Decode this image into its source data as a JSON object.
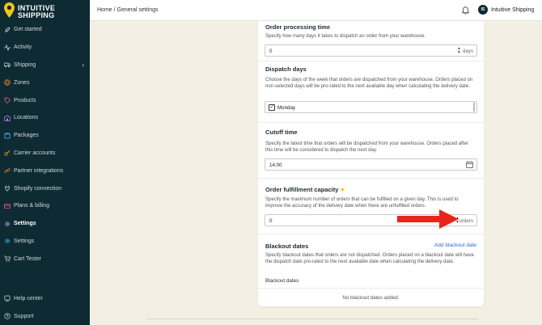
{
  "brand": {
    "line1": "INTUITIVE",
    "line2": "SHIPPING",
    "accent": "#f0c419"
  },
  "sidebar": {
    "items": [
      {
        "label": "Get started",
        "icon": "rocket-icon"
      },
      {
        "label": "Activity",
        "icon": "activity-icon"
      },
      {
        "label": "Shipping",
        "icon": "truck-icon",
        "has_chevron": true
      },
      {
        "label": "Zones",
        "icon": "globe-icon"
      },
      {
        "label": "Products",
        "icon": "tag-icon"
      },
      {
        "label": "Locations",
        "icon": "building-icon"
      },
      {
        "label": "Packages",
        "icon": "box-icon"
      },
      {
        "label": "Carrier accounts",
        "icon": "key-icon"
      },
      {
        "label": "Partner integrations",
        "icon": "link-icon"
      },
      {
        "label": "Shopify connection",
        "icon": "plug-icon"
      },
      {
        "label": "Plans & billing",
        "icon": "card-icon"
      },
      {
        "label": "Settings",
        "icon": "gear-icon",
        "active": true
      },
      {
        "label": "Settings",
        "icon": "gear-icon"
      },
      {
        "label": "Cart Tester",
        "icon": "cart-icon"
      }
    ],
    "bottom": [
      {
        "label": "Help center",
        "icon": "help-icon"
      },
      {
        "label": "Support",
        "icon": "support-icon"
      }
    ]
  },
  "topbar": {
    "breadcrumb": "Home / General settings",
    "avatar_initials": "IS",
    "account_name": "Intuitive Shipping"
  },
  "settings": {
    "order_processing": {
      "title": "Order processing time",
      "desc": "Specify how many days it takes to dispatch an order from your warehouse.",
      "value": "0",
      "unit": "days"
    },
    "dispatch_days": {
      "title": "Dispatch days",
      "desc": "Choose the days of the week that orders are dispatched from your warehouse. Orders placed on non-selected days will be pro-rated to the next available day when calculating the delivery date.",
      "selected": "Monday"
    },
    "cutoff": {
      "title": "Cutoff time",
      "desc": "Specify the latest time that orders will be dispatched from your warehouse. Orders placed after this time will be considered to dispatch the next day.",
      "value": "14:00"
    },
    "capacity": {
      "title": "Order fulfillment capacity",
      "desc": "Specify the maximum number of orders that can be fulfilled on a given day. This is used to improve the accuracy of the delivery date when there are unfulfilled orders.",
      "value": "0",
      "unit": "orders"
    },
    "blackout": {
      "title": "Blackout dates",
      "add_link": "Add blackout date",
      "desc": "Specify blackout dates that orders are not dispatched. Orders placed on a blackout date will have the dispatch date pro-rated to the next available date when calculating the delivery date.",
      "list_label": "Blackout dates",
      "empty": "No blackout dates added."
    }
  },
  "colors": {
    "sidebar": "#0e2a33",
    "page": "#f4efe3",
    "arrow": "#e8251c",
    "link": "#2f6ad0"
  }
}
